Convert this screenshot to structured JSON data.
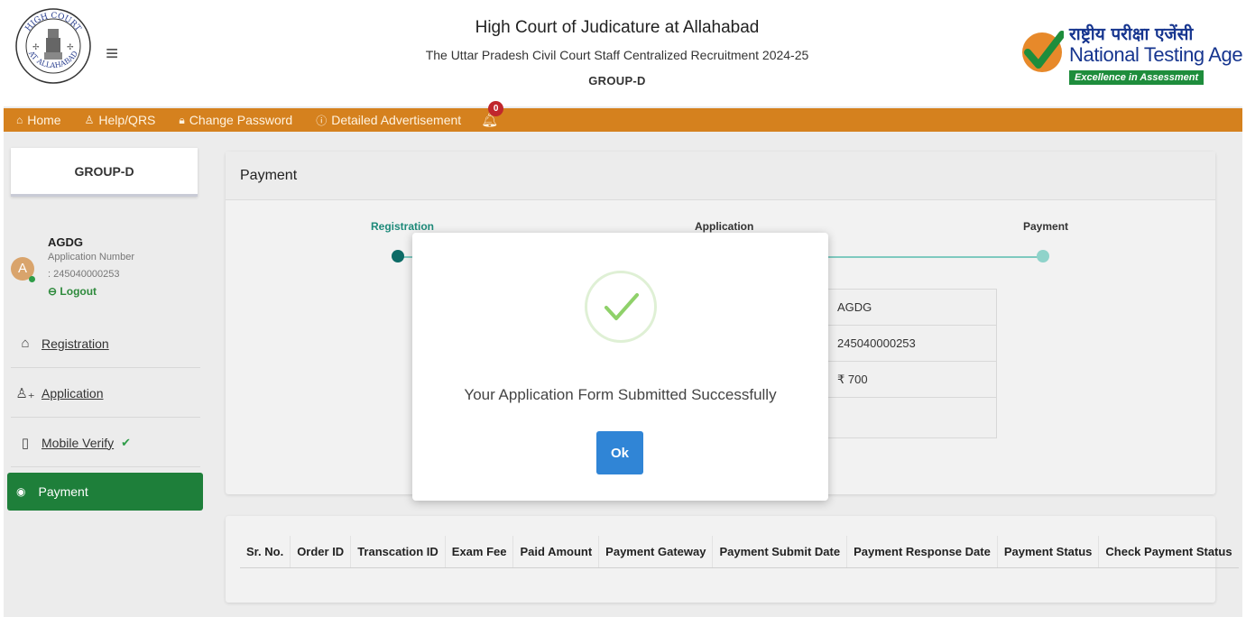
{
  "header": {
    "title": "High Court of Judicature at Allahabad",
    "subtitle": "The Uttar Pradesh Civil Court Staff Centralized Recruitment 2024-25",
    "group": "GROUP-D",
    "emblem_text_top": "HIGH COURT",
    "emblem_text_bottom": "AT ALLAHABAD",
    "nta_hindi": "राष्ट्रीय परीक्षा एजेंसी",
    "nta_english": "National Testing Agency",
    "nta_tagline": "Excellence in Assessment"
  },
  "nav": {
    "items": [
      {
        "label": "Home",
        "icon": "home-icon"
      },
      {
        "label": "Help/QRS",
        "icon": "user-icon"
      },
      {
        "label": "Change Password",
        "icon": "lock-icon"
      },
      {
        "label": "Detailed Advertisement",
        "icon": "info-icon"
      }
    ],
    "notification_count": "0"
  },
  "sidebar": {
    "group_label": "GROUP-D",
    "user": {
      "avatar_letter": "A",
      "name": "AGDG",
      "app_number_label": "Application Number",
      "app_number": ": 245040000253",
      "logout_label": "Logout"
    },
    "links": [
      {
        "label": "Registration",
        "icon": "home-outline-icon"
      },
      {
        "label": "Application",
        "icon": "user-add-icon"
      },
      {
        "label": "Mobile Verify",
        "icon": "mobile-icon"
      }
    ],
    "active": {
      "label": "Payment",
      "icon": "payment-icon"
    }
  },
  "main": {
    "title": "Payment",
    "steps": [
      "Registration",
      "Application",
      "Payment"
    ],
    "info_rows": [
      "AGDG",
      "245040000253",
      "₹ 700",
      ""
    ]
  },
  "payment_table": {
    "headers": [
      "Sr. No.",
      "Order ID",
      "Transcation ID",
      "Exam Fee",
      "Paid Amount",
      "Payment Gateway",
      "Payment Submit Date",
      "Payment Response Date",
      "Payment Status",
      "Check Payment Status"
    ]
  },
  "modal": {
    "message": "Your Application Form Submitted Successfully",
    "ok_label": "Ok"
  },
  "colors": {
    "nav_bg": "#d5811e",
    "active_green": "#1e7f3a",
    "ok_blue": "#3085d6",
    "check_green": "#8fd16a",
    "step_teal": "#7fcac0"
  }
}
